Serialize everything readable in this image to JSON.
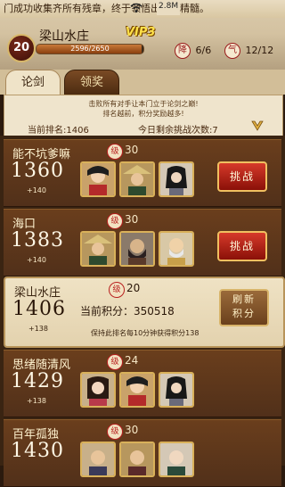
{
  "ticker": {
    "text": "门成功收集齐所有残章，终于领悟出一招精髓。",
    "speed": "2.8M"
  },
  "player": {
    "level": "20",
    "name": "梁山水庄",
    "vip": "VIP3",
    "exp_text": "2596/2650",
    "exp_fraction": 0.98,
    "stat1": "6/6",
    "stat1_icon": "降",
    "stat2": "12/12",
    "stat2_icon": "气"
  },
  "tabs": [
    {
      "label": "论剑",
      "active": true
    },
    {
      "label": "领奖",
      "active": false
    }
  ],
  "info": {
    "line1": "击败所有对手让本门立于论剑之巅!",
    "line2": "排名越前，积分奖励越多!",
    "rank_text": "当前排名:1406",
    "challenges_text": "今日剩余挑战次数:7"
  },
  "level_icon_char": "级",
  "opponents": [
    {
      "name": "能不坑爹嘛",
      "score": "1360",
      "delta": "+140",
      "level": "30",
      "button": "挑战"
    },
    {
      "name": "海口",
      "score": "1383",
      "delta": "+140",
      "level": "30",
      "button": "挑战"
    }
  ],
  "self": {
    "name": "梁山水庄",
    "score": "1406",
    "delta": "+138",
    "level": "20",
    "current_points": "当前积分：350518",
    "keep_text": "保持此排名每10分钟获得积分138",
    "refresh_line1": "刷新",
    "refresh_line2": "积分"
  },
  "others": [
    {
      "name": "思绪随清风",
      "score": "1429",
      "delta": "+138",
      "level": "24"
    },
    {
      "name": "百年孤独",
      "score": "1430",
      "delta": "",
      "level": "30"
    }
  ],
  "colors": {
    "accent_red": "#b81e1e",
    "card_brown": "#5a3418",
    "gold_border": "#d9b15a"
  }
}
